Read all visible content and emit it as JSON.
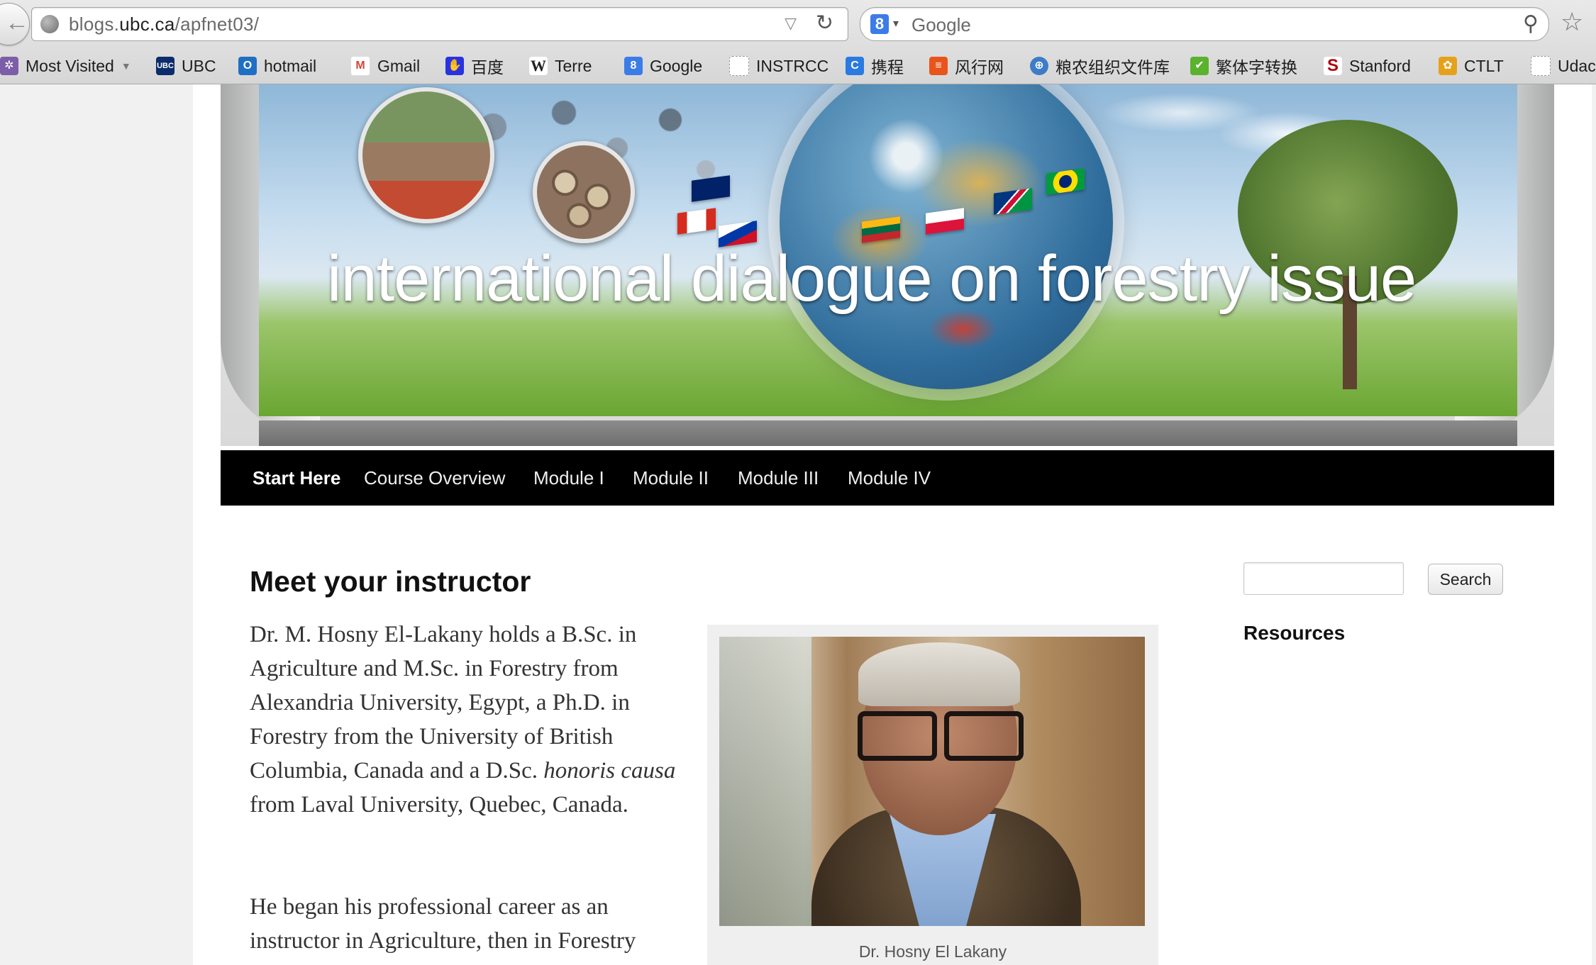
{
  "browser": {
    "url_prefix": "blogs.",
    "url_domain": "ubc.ca",
    "url_path": "/apfnet03/",
    "search_engine_icon": "8",
    "search_placeholder": "Google",
    "icons": [
      "back-arrow-icon",
      "globe-icon",
      "dropdown-triangle-icon",
      "reload-icon",
      "search-engine-icon",
      "magnifier-icon",
      "bookmark-star-icon"
    ]
  },
  "bookmarks": [
    {
      "label": "Most Visited",
      "icon": "most-visited-icon",
      "color": "#7b5ea7"
    },
    {
      "label": "UBC",
      "icon": "ubc-icon",
      "color": "#0c2c6a",
      "glyph": "UBC"
    },
    {
      "label": "hotmail",
      "icon": "outlook-icon",
      "color": "#1f6fc5",
      "glyph": "O"
    },
    {
      "label": "Gmail",
      "icon": "gmail-icon",
      "color": "#d44638",
      "glyph": "M"
    },
    {
      "label": "百度",
      "icon": "baidu-icon",
      "color": "#2932e1",
      "glyph": "✋"
    },
    {
      "label": "Terre",
      "icon": "wikipedia-icon",
      "color": "#ffffff",
      "glyph": "W"
    },
    {
      "label": "Google",
      "icon": "google-icon",
      "color": "#3b7ce8",
      "glyph": "8"
    },
    {
      "label": "INSTRCC",
      "icon": "blank-page-icon",
      "color": "#ffffff",
      "glyph": ""
    },
    {
      "label": "携程",
      "icon": "ctrip-icon",
      "color": "#2a7ae2",
      "glyph": "C"
    },
    {
      "label": "风行网",
      "icon": "funshion-icon",
      "color": "#e8541b",
      "glyph": "≡"
    },
    {
      "label": "粮农组织文件库",
      "icon": "fao-icon",
      "color": "#3e7cc6",
      "glyph": "⊕"
    },
    {
      "label": "繁体字转换",
      "icon": "hao-icon",
      "color": "#5ab22d",
      "glyph": "✔"
    },
    {
      "label": "Stanford",
      "icon": "stanford-icon",
      "color": "#b1040e",
      "glyph": "S"
    },
    {
      "label": "CTLT",
      "icon": "ctlt-icon",
      "color": "#e6a11c",
      "glyph": "✿"
    },
    {
      "label": "Udac",
      "icon": "blank-page-icon",
      "color": "#ffffff",
      "glyph": ""
    }
  ],
  "banner": {
    "title": "international dialogue on forestry issue"
  },
  "nav": {
    "items": [
      "Start Here",
      "Course Overview",
      "Module I",
      "Module II",
      "Module III",
      "Module IV"
    ]
  },
  "content": {
    "title": "Meet your instructor",
    "p1_a": "Dr. M. Hosny El-Lakany holds a B.Sc. in Agriculture and M.Sc. in Forestry from Alexandria University, Egypt, a Ph.D. in Forestry from the University of British Columbia, Canada and a D.Sc. ",
    "p1_em": "honoris causa",
    "p1_b": " from Laval University, Quebec, Canada.",
    "p2": "He began his professional career as an instructor in Agriculture, then in Forestry",
    "photo_caption": "Dr. Hosny El Lakany"
  },
  "sidebar": {
    "search_value": "",
    "search_button": "Search",
    "widget_title": "Resources"
  }
}
